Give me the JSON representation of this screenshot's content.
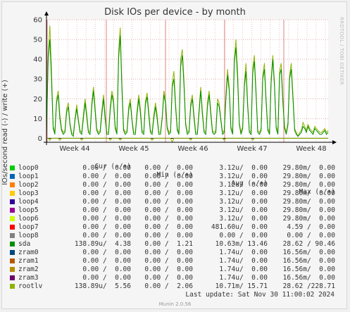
{
  "title": "Disk IOs per device - by month",
  "ylabel": "IOs/second read (-) / write (+)",
  "side_tag": "RRDTOOL / TOBI OETIKER",
  "last_update": "Last update: Sat Nov 30 11:00:02 2024",
  "version": "Munin 2.0.56",
  "legend_header": {
    "cur": "Cur (-/+)",
    "min": "Min (-/+)",
    "avg": "Avg (-/+)",
    "max": "Max (-/+)"
  },
  "legend": [
    {
      "name": "loop0",
      "color": "#00cc00",
      "cur": "0.00 /  0.00",
      "min": "0.00 /  0.00",
      "avg": "3.12u/  0.00",
      "max": "29.80m/  0.00"
    },
    {
      "name": "loop1",
      "color": "#0066b3",
      "cur": "0.00 /  0.00",
      "min": "0.00 /  0.00",
      "avg": "3.12u/  0.00",
      "max": "29.80m/  0.00"
    },
    {
      "name": "loop2",
      "color": "#ff8000",
      "cur": "0.00 /  0.00",
      "min": "0.00 /  0.00",
      "avg": "3.12u/  0.00",
      "max": "29.80m/  0.00"
    },
    {
      "name": "loop3",
      "color": "#ffcc00",
      "cur": "0.00 /  0.00",
      "min": "0.00 /  0.00",
      "avg": "3.12u/  0.00",
      "max": "29.80m/  0.00"
    },
    {
      "name": "loop4",
      "color": "#330099",
      "cur": "0.00 /  0.00",
      "min": "0.00 /  0.00",
      "avg": "3.12u/  0.00",
      "max": "29.80m/  0.00"
    },
    {
      "name": "loop5",
      "color": "#990099",
      "cur": "0.00 /  0.00",
      "min": "0.00 /  0.00",
      "avg": "3.12u/  0.00",
      "max": "29.80m/  0.00"
    },
    {
      "name": "loop6",
      "color": "#ccff00",
      "cur": "0.00 /  0.00",
      "min": "0.00 /  0.00",
      "avg": "3.12u/  0.00",
      "max": "29.80m/  0.00"
    },
    {
      "name": "loop7",
      "color": "#ff0000",
      "cur": "0.00 /  0.00",
      "min": "0.00 /  0.00",
      "avg": "481.60u/  0.00",
      "max": "4.59 /  0.00"
    },
    {
      "name": "loop8",
      "color": "#808080",
      "cur": "0.00 /  0.00",
      "min": "0.00 /  0.00",
      "avg": "0.00 /  0.00",
      "max": "0.00 /  0.00"
    },
    {
      "name": "sda",
      "color": "#008f00",
      "cur": "138.89u/  4.38",
      "min": "0.00 /  1.21",
      "avg": "10.63m/ 13.46",
      "max": "28.62 / 90.46"
    },
    {
      "name": "zram0",
      "color": "#00487d",
      "cur": "0.00 /  0.00",
      "min": "0.00 /  0.00",
      "avg": "1.74u/  0.00",
      "max": "16.56m/  0.00"
    },
    {
      "name": "zram1",
      "color": "#b35a00",
      "cur": "0.00 /  0.00",
      "min": "0.00 /  0.00",
      "avg": "1.74u/  0.00",
      "max": "16.56m/  0.00"
    },
    {
      "name": "zram2",
      "color": "#b38f00",
      "cur": "0.00 /  0.00",
      "min": "0.00 /  0.00",
      "avg": "1.74u/  0.00",
      "max": "16.56m/  0.00"
    },
    {
      "name": "zram3",
      "color": "#6b006b",
      "cur": "0.00 /  0.00",
      "min": "0.00 /  0.00",
      "avg": "1.74u/  0.00",
      "max": "16.56m/  0.00"
    },
    {
      "name": "rootlv",
      "color": "#8fb300",
      "cur": "138.89u/  5.56",
      "min": "0.00 /  2.06",
      "avg": "10.71m/ 15.71",
      "max": "28.62 /228.71"
    }
  ],
  "chart_data": {
    "type": "line",
    "title": "Disk IOs per device - by month",
    "ylabel": "IOs/second read (-) / write (+)",
    "ylim": [
      -2,
      60
    ],
    "yticks": [
      0,
      10,
      20,
      30,
      40,
      50,
      60
    ],
    "x_ticks": [
      "Week 44",
      "Week 45",
      "Week 46",
      "Week 47",
      "Week 48"
    ],
    "grid": true,
    "series": [
      {
        "name": "rootlv",
        "color": "#8fb300",
        "values": [
          3,
          42,
          57,
          35,
          6,
          3,
          20,
          24,
          12,
          5,
          3,
          4,
          15,
          18,
          8,
          3,
          2,
          10,
          17,
          10,
          4,
          3,
          12,
          20,
          13,
          4,
          3,
          18,
          26,
          16,
          5,
          3,
          4,
          14,
          22,
          12,
          3,
          3,
          16,
          24,
          20,
          6,
          3,
          44,
          56,
          27,
          5,
          3,
          4,
          16,
          20,
          10,
          3,
          3,
          14,
          22,
          15,
          4,
          3,
          19,
          23,
          14,
          4,
          3,
          12,
          18,
          12,
          3,
          3,
          11,
          24,
          20,
          6,
          3,
          4,
          28,
          34,
          18,
          5,
          3,
          40,
          45,
          30,
          8,
          3,
          4,
          18,
          22,
          12,
          3,
          3,
          15,
          26,
          14,
          4,
          3,
          18,
          24,
          14,
          4,
          3,
          4,
          20,
          18,
          10,
          3,
          4,
          22,
          35,
          26,
          6,
          3,
          40,
          50,
          34,
          8,
          3,
          6,
          28,
          38,
          18,
          4,
          3,
          36,
          42,
          24,
          4,
          3,
          5,
          32,
          38,
          20,
          5,
          3,
          30,
          42,
          28,
          6,
          3,
          34,
          38,
          20,
          6,
          3,
          8,
          32,
          38,
          22,
          5,
          3,
          1,
          3,
          4,
          8,
          6,
          4,
          7,
          5,
          4,
          3,
          6,
          5,
          4,
          3,
          3,
          4,
          5,
          3,
          4
        ]
      },
      {
        "name": "sda",
        "color": "#008f00",
        "values": [
          2,
          40,
          50,
          30,
          5,
          2,
          18,
          22,
          10,
          4,
          2,
          3,
          13,
          16,
          7,
          2,
          1,
          9,
          15,
          9,
          3,
          2,
          10,
          18,
          11,
          3,
          2,
          16,
          24,
          14,
          4,
          2,
          3,
          12,
          20,
          10,
          2,
          2,
          14,
          22,
          18,
          5,
          2,
          40,
          52,
          25,
          4,
          2,
          3,
          14,
          18,
          9,
          2,
          2,
          12,
          20,
          13,
          3,
          2,
          17,
          21,
          12,
          3,
          2,
          10,
          16,
          10,
          2,
          2,
          10,
          22,
          18,
          5,
          2,
          3,
          26,
          30,
          16,
          4,
          2,
          36,
          42,
          27,
          7,
          2,
          3,
          16,
          20,
          10,
          2,
          2,
          13,
          24,
          12,
          3,
          2,
          16,
          22,
          12,
          3,
          2,
          3,
          18,
          16,
          9,
          2,
          3,
          20,
          32,
          24,
          5,
          2,
          38,
          46,
          30,
          7,
          2,
          5,
          26,
          34,
          16,
          3,
          2,
          33,
          39,
          22,
          3,
          2,
          4,
          30,
          35,
          18,
          4,
          2,
          28,
          40,
          26,
          5,
          2,
          32,
          35,
          18,
          5,
          2,
          7,
          30,
          35,
          20,
          4,
          2,
          1,
          2,
          3,
          6,
          5,
          3,
          6,
          4,
          3,
          2,
          5,
          4,
          3,
          2,
          2,
          3,
          4,
          2,
          3
        ]
      }
    ],
    "negative_series": {
      "name": "rootlv",
      "color": "#8fb300",
      "values": [
        0,
        0,
        -1,
        0,
        0,
        0,
        0,
        0,
        -1,
        0,
        0,
        0,
        0,
        0,
        0,
        0,
        0,
        0,
        0,
        0,
        0,
        -1,
        0,
        0,
        0,
        0,
        0,
        0,
        0,
        0,
        0,
        0,
        0,
        0,
        0,
        0,
        0,
        0,
        -1,
        0,
        0,
        0,
        0,
        0,
        -1,
        0,
        0,
        0,
        0,
        0,
        0,
        0,
        0,
        0,
        0,
        0,
        0,
        0,
        0,
        0,
        0,
        0,
        0,
        -1,
        0,
        0,
        0,
        0,
        0,
        0,
        0,
        0,
        0,
        0,
        0,
        -2,
        0,
        0,
        0,
        0,
        0,
        0,
        0,
        0,
        0,
        0,
        -1,
        0,
        0,
        0,
        0,
        0,
        0,
        0,
        0,
        0,
        0,
        0,
        0,
        0,
        0,
        0,
        0,
        0,
        0,
        0,
        -1,
        0,
        0,
        0,
        0,
        0,
        0,
        0,
        0,
        0,
        0,
        0,
        0,
        0,
        0,
        0,
        0,
        -1,
        0,
        0,
        0,
        0,
        0,
        0,
        0,
        0,
        0,
        0,
        0,
        0,
        0,
        0,
        0,
        0,
        0,
        0,
        0,
        0,
        0,
        0,
        0,
        0,
        0,
        0,
        0,
        0,
        0,
        0,
        0,
        0,
        0,
        0,
        0,
        0,
        0,
        0,
        0,
        0,
        0,
        0,
        0,
        0,
        0
      ]
    }
  }
}
